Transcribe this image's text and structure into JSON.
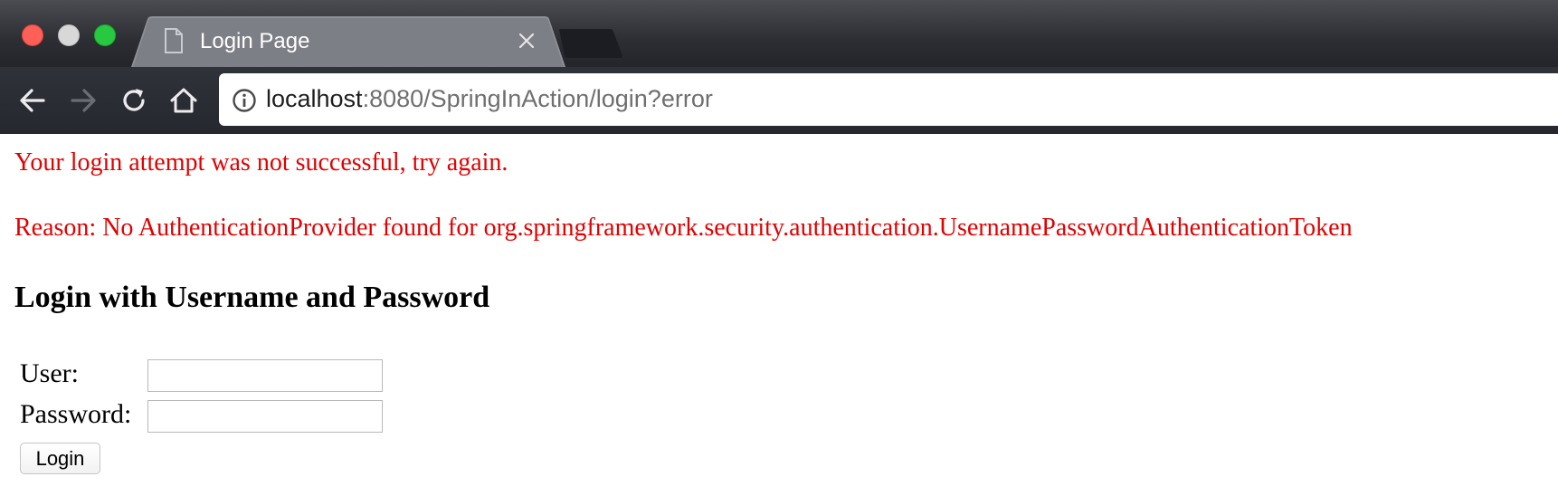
{
  "browser": {
    "tab_title": "Login Page",
    "url_host": "localhost",
    "url_rest": ":8080/SpringInAction/login?error",
    "icons": {
      "back": "back-arrow-icon",
      "forward": "forward-arrow-icon",
      "reload": "reload-icon",
      "home": "home-icon",
      "info": "info-icon",
      "tab_close": "close-icon",
      "page": "document-icon"
    },
    "colors": {
      "close": "#fe5f57",
      "minimize": "#d8d8d8",
      "maximize": "#28c840"
    }
  },
  "page": {
    "error_message": "Your login attempt was not successful, try again.",
    "error_reason": "Reason: No AuthenticationProvider found for org.springframework.security.authentication.UsernamePasswordAuthenticationToken",
    "heading": "Login with Username and Password",
    "user_label": "User:",
    "user_value": "",
    "password_label": "Password:",
    "password_value": "",
    "login_button": "Login",
    "colors": {
      "error": "#e20000"
    }
  }
}
